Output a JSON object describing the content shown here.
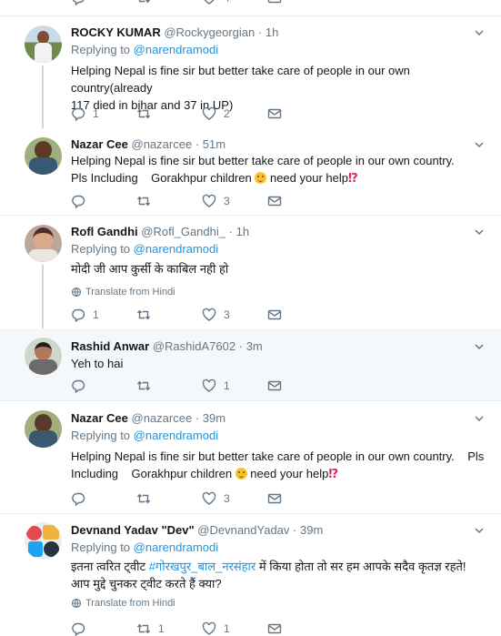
{
  "top_partial": {
    "reply_count": "",
    "retweet_count": "",
    "like_count": "4"
  },
  "tweets": [
    {
      "name": "ROCKY KUMAR",
      "handle": "@Rockygeorgian",
      "time": "1h",
      "replying_label": "Replying to",
      "replying_to": "@narendramodi",
      "text_lines": [
        "Helping Nepal is fine sir but better take care of people in our own country(already",
        "117 died in bihar and 37 in UP)"
      ],
      "replies": "1",
      "retweets": "",
      "likes": "2"
    },
    {
      "name": "Nazar Cee",
      "handle": "@nazarcee",
      "time": "51m",
      "text_line1": "Helping Nepal is fine sir but better take care of people in our own country.",
      "text_line2_a": "Pls Including    Gorakhpur children",
      "text_line2_b": "need your help",
      "emoji_excl": "⁉",
      "replies": "",
      "retweets": "",
      "likes": "3"
    },
    {
      "name": "Rofl Gandhi",
      "handle": "@Rofl_Gandhi_",
      "time": "1h",
      "replying_label": "Replying to",
      "replying_to": "@narendramodi",
      "text": "मोदी जी आप कुर्सी के काबिल नही हो",
      "translate": "Translate from Hindi",
      "replies": "1",
      "retweets": "",
      "likes": "3"
    },
    {
      "name": "Rashid Anwar",
      "handle": "@RashidA7602",
      "time": "3m",
      "text": "Yeh to hai",
      "replies": "",
      "retweets": "",
      "likes": "1"
    },
    {
      "name": "Nazar Cee",
      "handle": "@nazarcee",
      "time": "39m",
      "replying_label": "Replying to",
      "replying_to": "@narendramodi",
      "text_line1": "Helping Nepal is fine sir but better take care of people in our own country.    Pls",
      "text_line2_a": "Including    Gorakhpur children",
      "text_line2_b": "need your help",
      "emoji_excl": "⁉",
      "replies": "",
      "retweets": "",
      "likes": "3"
    },
    {
      "name": "Devnand Yadav \"Dev\"",
      "handle": "@DevnandYadav",
      "time": "39m",
      "replying_label": "Replying to",
      "replying_to": "@narendramodi",
      "text_a": "इतना त्वरित ट्वीट ",
      "hashtag": "#गोरखपुर_बाल_नरसंहार",
      "text_b": " में किया होता तो सर हम आपके सदैव कृतज्ञ रहते!",
      "text_line2": "आप मुद्दे चुनकर ट्वीट करते हैं क्या?",
      "translate": "Translate from Hindi",
      "replies": "",
      "retweets": "1",
      "likes": "1"
    }
  ],
  "dot": "·",
  "colors": {
    "link": "#1b95e0",
    "muted": "#657786",
    "text": "#14171a",
    "highlight_bg": "#f5f8fa",
    "thread_line": "#ccd6dd"
  }
}
